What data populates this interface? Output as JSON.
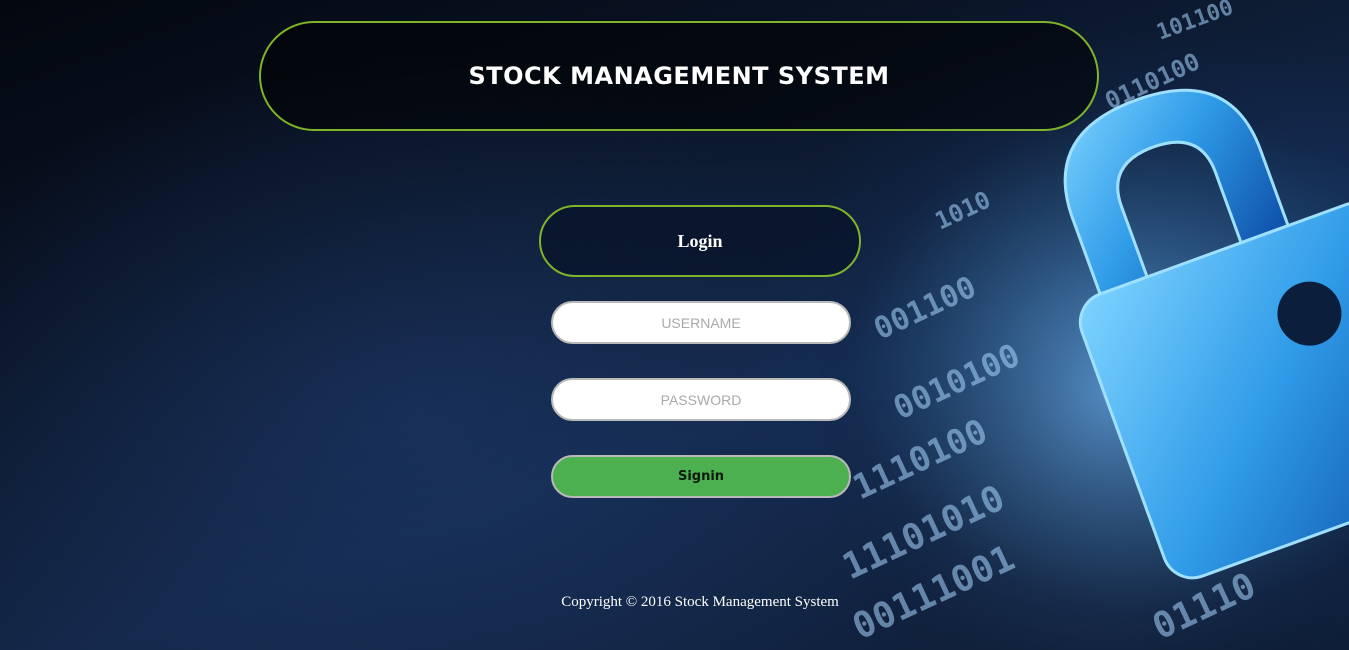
{
  "header": {
    "title": "STOCK MANAGEMENT SYSTEM"
  },
  "login": {
    "title": "Login",
    "username_placeholder": "USERNAME",
    "password_placeholder": "PASSWORD",
    "signin_label": "Signin"
  },
  "footer": {
    "copyright": "Copyright © 2016 Stock Management System"
  },
  "background": {
    "icon": "padlock-icon",
    "theme": "binary digits security background"
  },
  "colors": {
    "border_accent": "#7fb32a",
    "signin_button": "#4caf50",
    "background_dark": "#0a1426",
    "padlock_blue": "#2f9be8"
  }
}
